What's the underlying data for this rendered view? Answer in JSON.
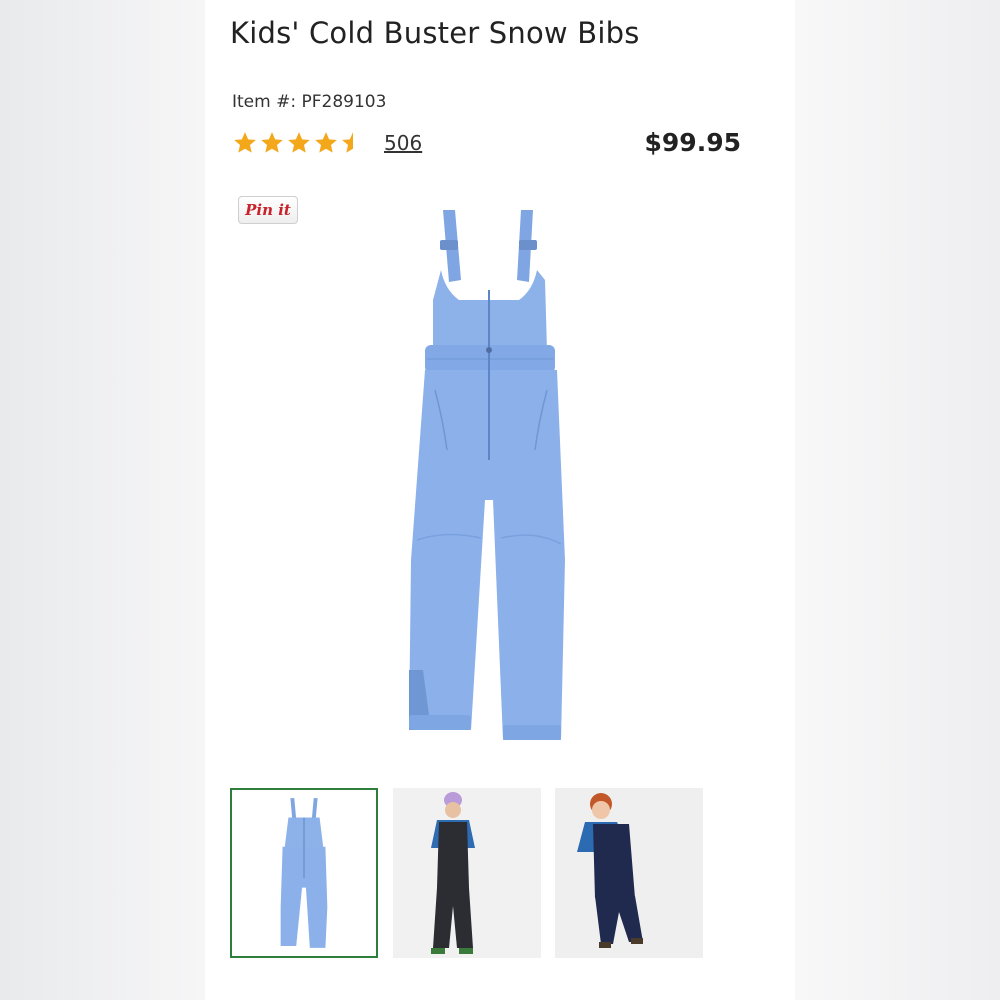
{
  "product": {
    "title": "Kids' Cold Buster Snow Bibs",
    "item_number": "Item #: PF289103",
    "rating": 4.5,
    "review_count": "506",
    "price": "$99.95"
  },
  "share": {
    "pinterest_label": "Pin it"
  },
  "gallery": {
    "selected_index": 0,
    "product_color": "#86aee8",
    "thumbnails": [
      "product-only",
      "girl-model",
      "boy-model"
    ]
  },
  "colors": {
    "star": "#f3a81c",
    "price": "#222222",
    "selected_border": "#2f7d3a",
    "pin": "#c8232c"
  }
}
